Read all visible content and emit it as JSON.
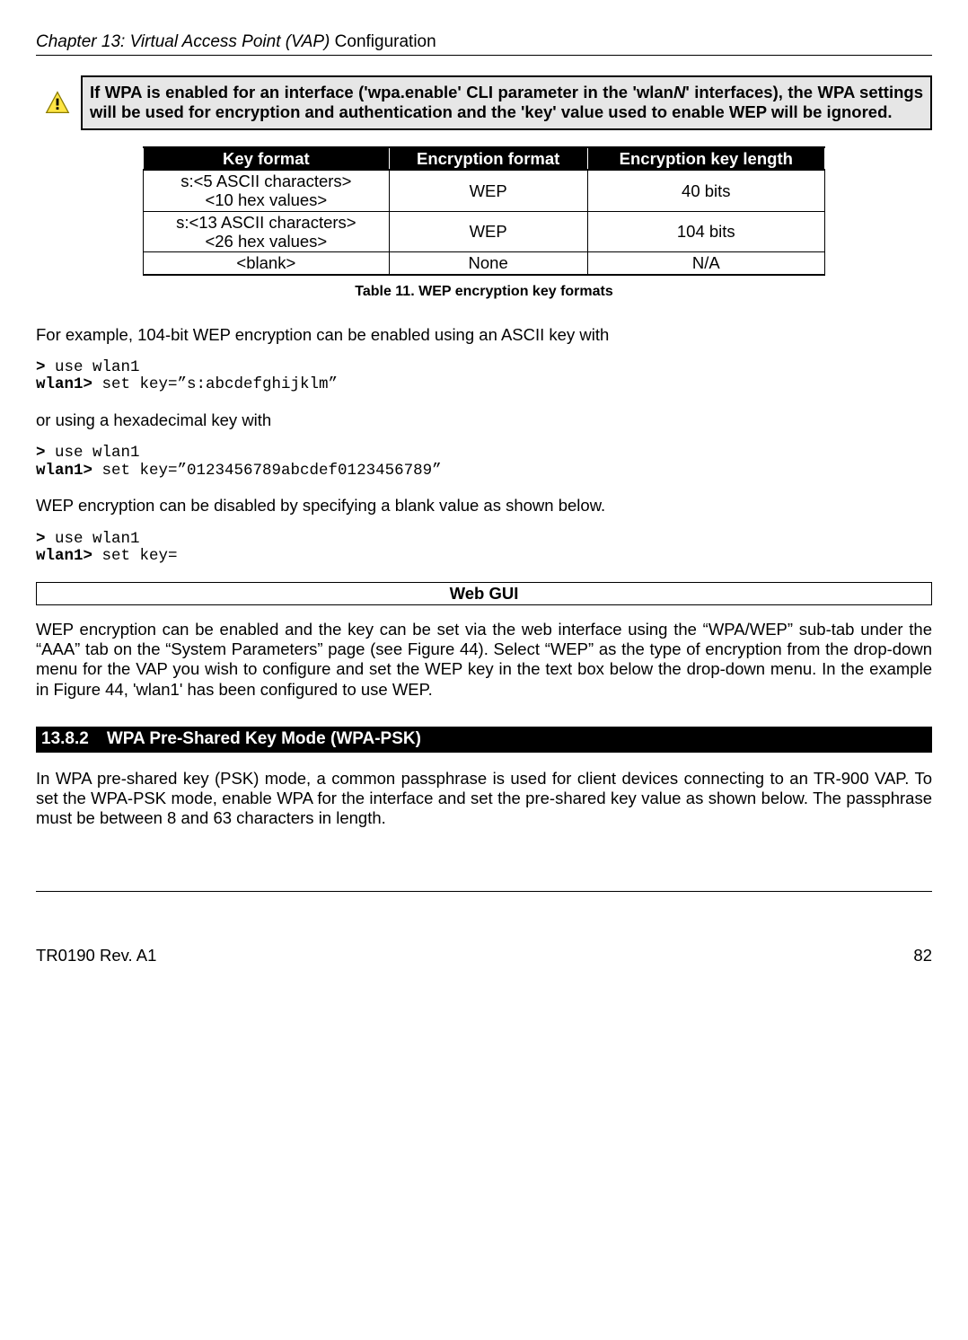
{
  "header": {
    "chapter_prefix": "Chapter 13: Virtual Access Point (VAP)",
    "chapter_suffix": " Configuration"
  },
  "callout": {
    "line": "If WPA is enabled for an interface ('wpa.enable' CLI parameter in the 'wlan",
    "italic": "N",
    "line_end": "' interfaces), the WPA settings will be used for encryption and authentication and the 'key' value used to enable WEP will be ignored."
  },
  "table": {
    "headers": {
      "c1": "Key format",
      "c2": "Encryption format",
      "c3": "Encryption key length"
    },
    "rows": [
      {
        "c1a": "s:<5 ASCII characters>",
        "c1b": "<10 hex values>",
        "c2": "WEP",
        "c3": "40 bits"
      },
      {
        "c1a": "s:<13 ASCII characters>",
        "c1b": "<26 hex values>",
        "c2": "WEP",
        "c3": "104 bits"
      },
      {
        "c1a": "<blank>",
        "c1b": "",
        "c2": "None",
        "c3": "N/A"
      }
    ],
    "caption": "Table 11. WEP encryption key formats"
  },
  "para1": "For example, 104-bit WEP encryption can be enabled using an ASCII key with",
  "cli1": {
    "p1": ">",
    "cmd1": " use wlan1",
    "p2": "wlan1>",
    "cmd2": " set key=”s:abcdefghijklm”"
  },
  "para2": "or using a hexadecimal key with",
  "cli2": {
    "p1": ">",
    "cmd1": " use wlan1",
    "p2": "wlan1>",
    "cmd2": " set key=”0123456789abcdef0123456789”"
  },
  "para3": "WEP encryption can be disabled by specifying a blank value as shown below.",
  "cli3": {
    "p1": ">",
    "cmd1": " use wlan1",
    "p2": "wlan1>",
    "cmd2": " set key="
  },
  "webgui_label": "Web GUI",
  "para4": "WEP encryption can be enabled and the key can be set via the web interface using the “WPA/WEP” sub-tab under the “AAA” tab on the “System Parameters” page (see Figure 44). Select “WEP” as the type of encryption from the drop-down menu for the VAP you wish to configure and set the WEP key in the text box below the drop-down menu. In the example in Figure 44, 'wlan1' has been configured to use WEP.",
  "section": {
    "num": "13.8.2",
    "title": "WPA Pre-Shared Key Mode (WPA-PSK)"
  },
  "para5": "In WPA pre-shared key (PSK) mode, a common passphrase is used for client devices connecting to an TR-900 VAP. To set the WPA-PSK mode, enable WPA for the interface and set the pre-shared key value as shown below. The passphrase must be between 8 and 63 characters in length.",
  "footer": {
    "left": "TR0190 Rev. A1",
    "right": "82"
  }
}
